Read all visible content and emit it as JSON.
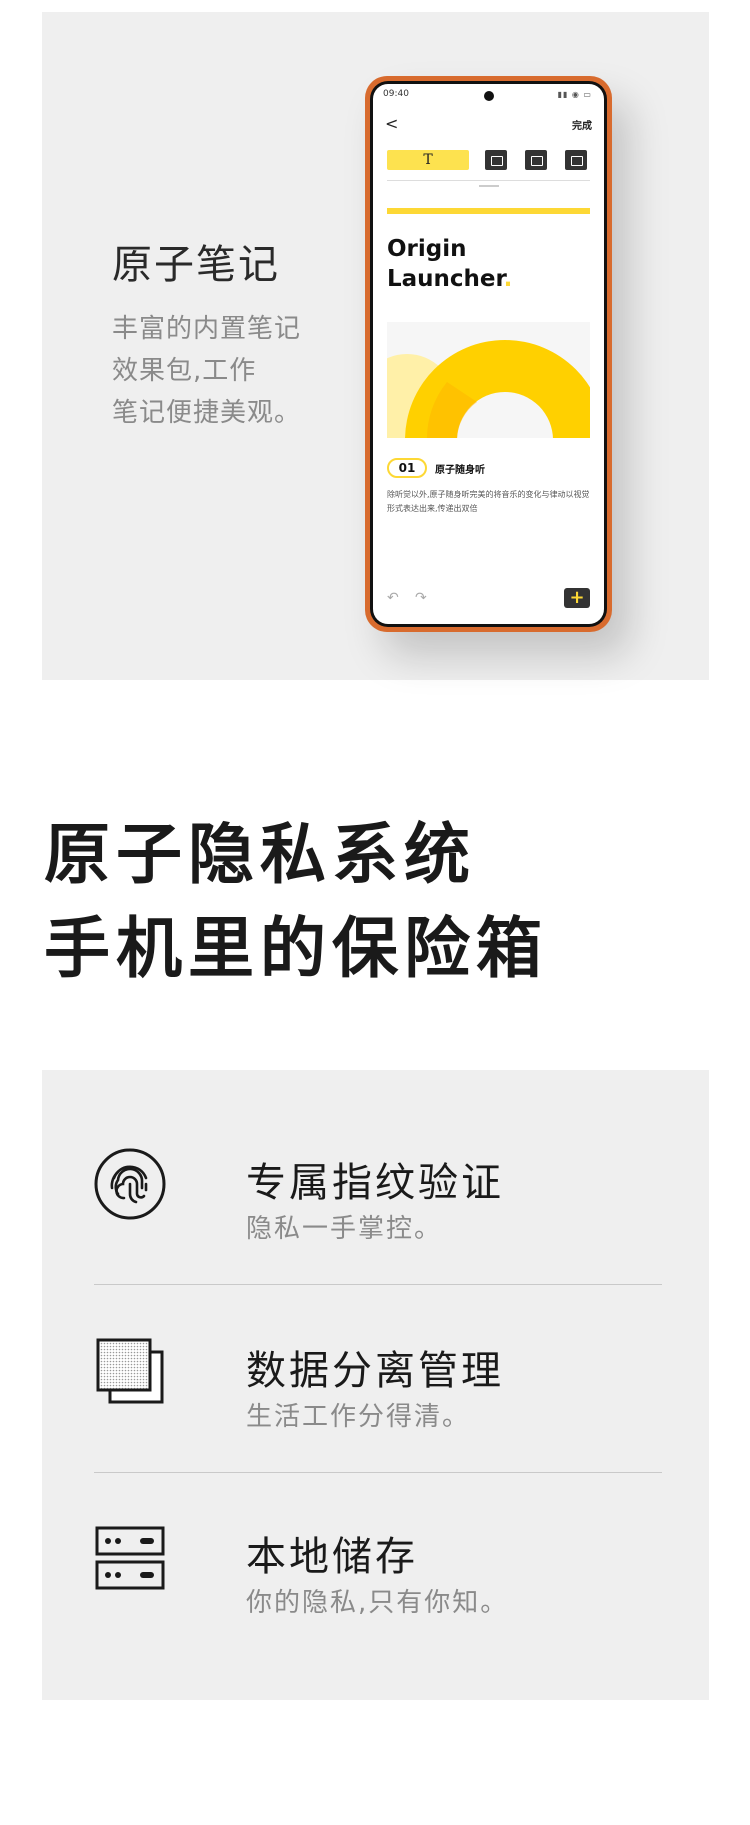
{
  "notes": {
    "title": "原子笔记",
    "desc_lines": [
      "丰富的内置笔记",
      "效果包,工作",
      "笔记便捷美观。"
    ]
  },
  "phone": {
    "status_time": "09:40",
    "status_icons": "▮▮ ◉ ▭",
    "back_glyph": "<",
    "done_label": "完成",
    "tool_text_glyph": "T",
    "doc_title_line1": "Origin",
    "doc_title_line2": "Launcher",
    "doc_title_dot": ".",
    "section_number": "01",
    "section_title": "原子随身听",
    "body_text": "除听觉以外,原子随身听完美的将音乐的变化与律动以视觉形式表达出来,传递出双倍",
    "undo_glyph": "↶",
    "redo_glyph": "↷",
    "add_glyph": "+"
  },
  "headline": {
    "line1": "原子隐私系统",
    "line2": "手机里的保险箱"
  },
  "privacy": {
    "items": [
      {
        "icon": "fingerprint-icon",
        "title": "专属指纹验证",
        "subtitle": "隐私一手掌控。"
      },
      {
        "icon": "stacked-layers-icon",
        "title": "数据分离管理",
        "subtitle": "生活工作分得清。"
      },
      {
        "icon": "server-storage-icon",
        "title": "本地储存",
        "subtitle": "你的隐私,只有你知。"
      }
    ]
  },
  "colors": {
    "accent_yellow": "#fdd835",
    "phone_frame": "#d86b2e",
    "card_bg": "#efefef"
  }
}
